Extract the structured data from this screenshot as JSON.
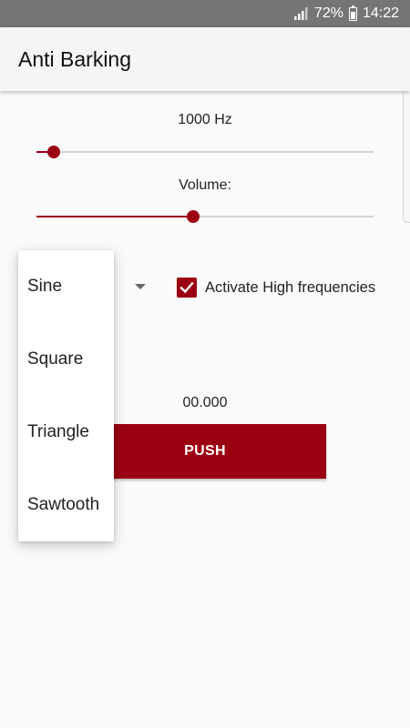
{
  "status_bar": {
    "battery_percent": "72%",
    "time": "14:22"
  },
  "app_bar": {
    "title": "Anti Barking"
  },
  "frequency": {
    "label": "1000 Hz",
    "level": 0.05
  },
  "volume": {
    "label": "Volume:",
    "level": 0.465
  },
  "waveform": {
    "options": [
      "Sine",
      "Square",
      "Triangle",
      "Sawtooth"
    ]
  },
  "high_frequencies": {
    "label": "Activate High frequencies",
    "checked": true
  },
  "timer": {
    "value": "00.000"
  },
  "push_button": {
    "label": "PUSH"
  },
  "colors": {
    "accent": "#9b0012",
    "status_bar": "#757575",
    "app_bar": "#f5f5f5",
    "background": "#fafafa"
  }
}
